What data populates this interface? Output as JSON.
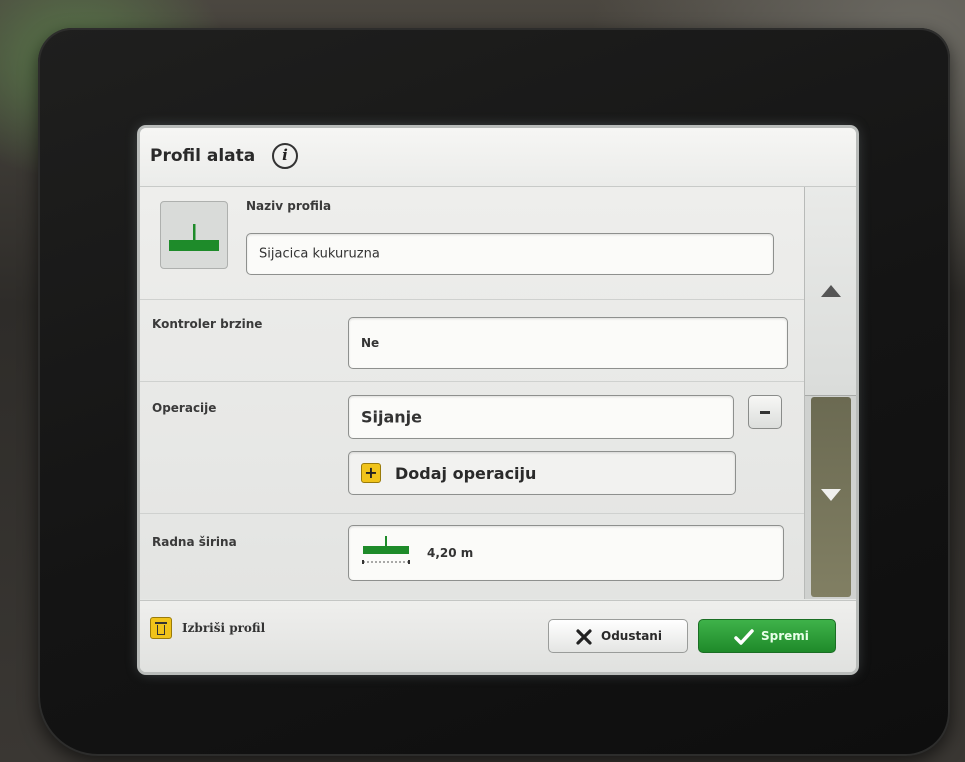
{
  "screen": {
    "title": "Profil alata",
    "profile_name_label": "Naziv profila",
    "profile_name_value": "Sijacica kukuruzna",
    "speed_controller_label": "Kontroler brzine",
    "speed_controller_value": "Ne",
    "operations_label": "Operacije",
    "operation_1": "Sijanje",
    "add_operation_label": "Dodaj operaciju",
    "working_width_label": "Radna širina",
    "working_width_value": "4,20 m"
  },
  "footer": {
    "delete_label": "Izbriši profil",
    "cancel_label": "Odustani",
    "save_label": "Spremi"
  },
  "colors": {
    "accent_green": "#1f8a2a",
    "implement_green": "#1e8b2a",
    "warning_yellow": "#f0c31a"
  },
  "icons": [
    "info-icon",
    "implement-icon",
    "scroll-up-icon",
    "scroll-down-icon",
    "minus-icon",
    "plus-icon",
    "trash-icon",
    "close-x-icon",
    "checkmark-icon"
  ]
}
